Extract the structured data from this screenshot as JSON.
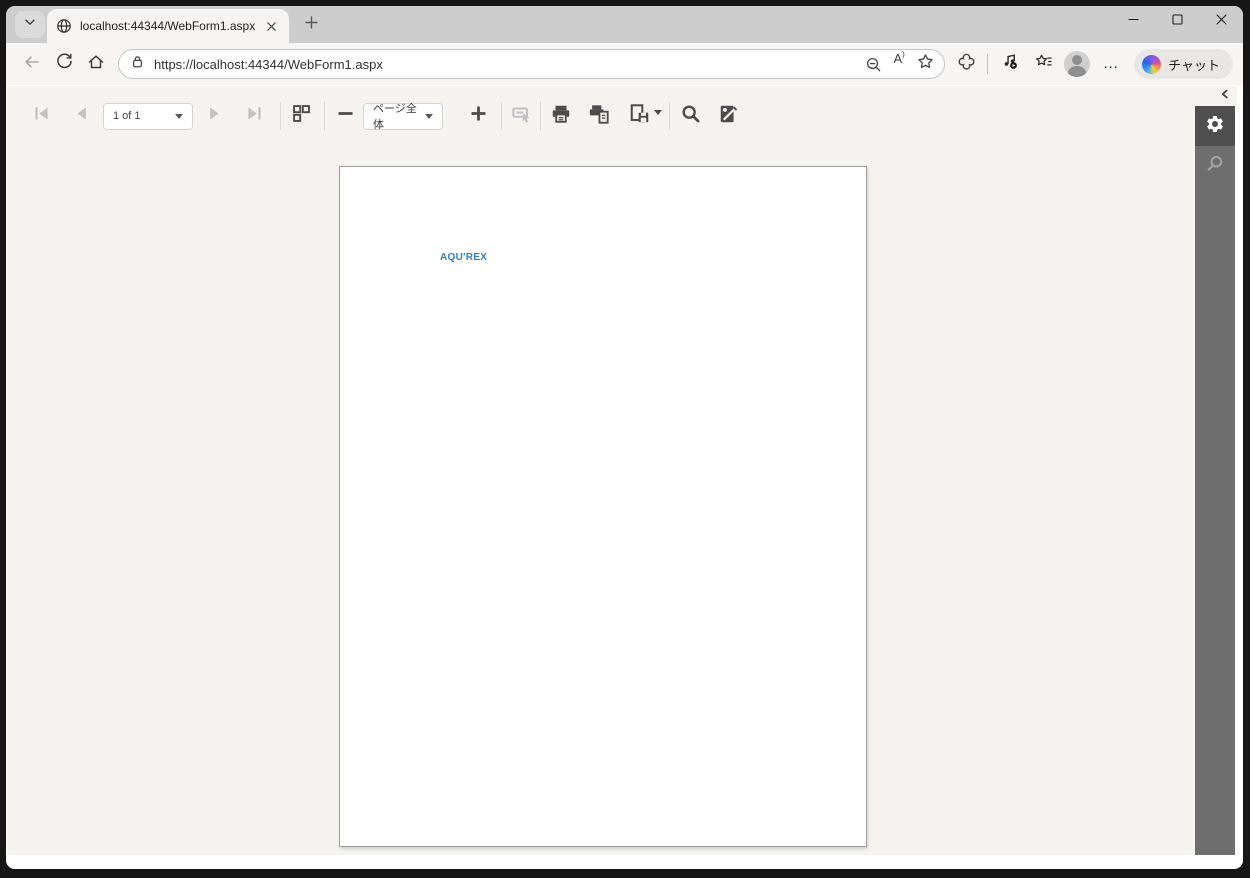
{
  "browser": {
    "tab_title": "localhost:44344/WebForm1.aspx",
    "url": "https://localhost:44344/WebForm1.aspx",
    "copilot_label": "チャット"
  },
  "icons": {
    "read_aloud_glyph": "A",
    "read_aloud_mark": ")",
    "more_dots_glyph": "…"
  },
  "report_viewer": {
    "toolbar": {
      "page_indicator": "1 of 1",
      "zoom_value": "ページ全体"
    },
    "document": {
      "logo_text": "AQU'REX"
    }
  },
  "colors": {
    "logo_blue": "#2e80c5",
    "viewer_background": "#f5f4f1",
    "rail_background": "#6e6e6e",
    "rail_active_background": "#4f4f4f",
    "chrome_background": "#f7f5f3",
    "titlebar_background": "#cecdcd"
  }
}
